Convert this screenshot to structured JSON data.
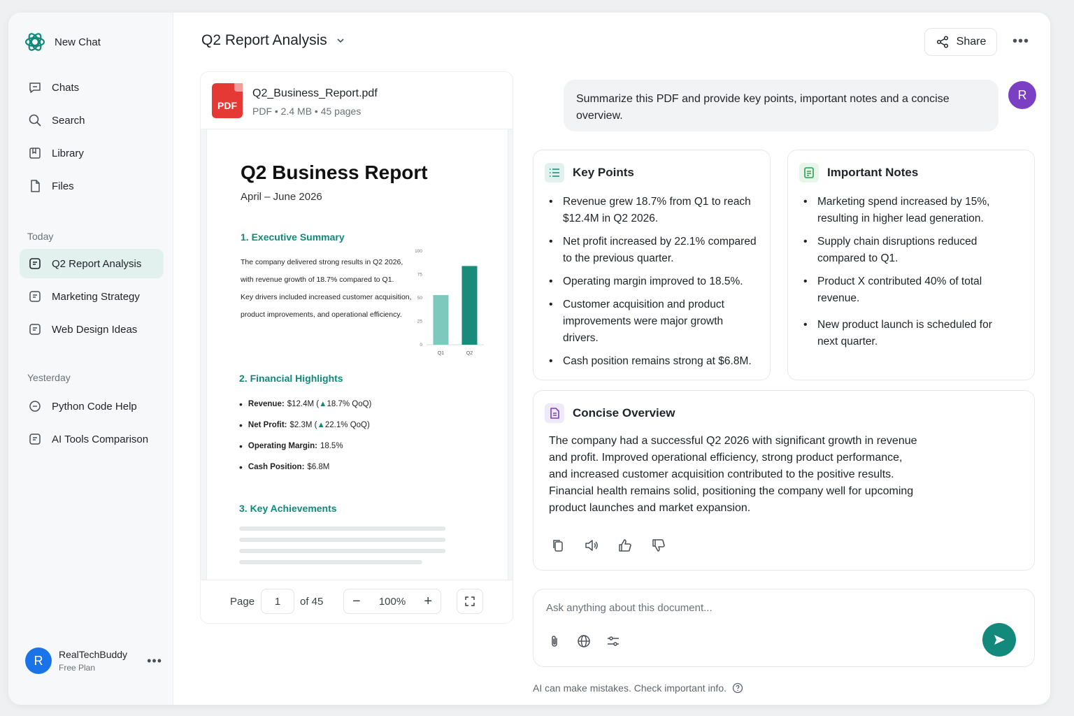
{
  "sidebar": {
    "new_chat": "New Chat",
    "nav": [
      {
        "label": "Chats"
      },
      {
        "label": "Search"
      },
      {
        "label": "Library"
      },
      {
        "label": "Files"
      }
    ],
    "today_label": "Today",
    "today": [
      {
        "label": "Q2 Report Analysis"
      },
      {
        "label": "Marketing Strategy"
      },
      {
        "label": "Web Design Ideas"
      }
    ],
    "yesterday_label": "Yesterday",
    "yesterday": [
      {
        "label": "Python Code Help"
      },
      {
        "label": "AI Tools Comparison"
      }
    ],
    "user": {
      "initial": "R",
      "name": "RealTechBuddy",
      "plan": "Free Plan"
    }
  },
  "header": {
    "title": "Q2 Report Analysis",
    "share": "Share"
  },
  "pdf": {
    "badge": "PDF",
    "file_name": "Q2_Business_Report.pdf",
    "file_meta": "PDF • 2.4 MB • 45 pages",
    "doc_title": "Q2 Business Report",
    "doc_subtitle": "April – June 2026",
    "sec1": "1. Executive Summary",
    "sec1_lines": [
      "The company delivered strong results in Q2 2026,",
      "with revenue growth of 18.7% compared to Q1.",
      "Key drivers included increased customer acquisition,",
      "product improvements, and operational efficiency."
    ],
    "sec2": "2. Financial Highlights",
    "fin": [
      {
        "label": "Revenue:",
        "value": "$12.4M (",
        "delta": "▲",
        "tail": " 18.7% QoQ)"
      },
      {
        "label": "Net Profit:",
        "value": "$2.3M (",
        "delta": "▲",
        "tail": " 22.1% QoQ)"
      },
      {
        "label": "Operating Margin:",
        "value": "18.5%",
        "delta": "",
        "tail": ""
      },
      {
        "label": "Cash Position:",
        "value": "$6.8M",
        "delta": "",
        "tail": ""
      }
    ],
    "sec3": "3. Key Achievements",
    "pager": {
      "page_label": "Page",
      "page": "1",
      "of": "of 45",
      "zoom": "100%"
    }
  },
  "chart_data": {
    "type": "bar",
    "categories": [
      "Q1",
      "Q2"
    ],
    "values": [
      53,
      84
    ],
    "ylim": [
      0,
      100
    ],
    "yticks": [
      "100",
      "75",
      "50",
      "25",
      "0"
    ],
    "colors": [
      "#7dc9bd",
      "#1a8a7a"
    ]
  },
  "chat": {
    "user_initial": "R",
    "user_message": "Summarize this PDF and provide key points, important notes and a concise overview.",
    "key_points_title": "Key Points",
    "key_points": [
      "Revenue grew 18.7% from Q1 to reach $12.4M in Q2 2026.",
      "Net profit increased by 22.1% compared to the previous quarter.",
      "Operating margin improved to 18.5%.",
      "Customer acquisition and product improvements were major growth drivers.",
      "Cash position remains strong at $6.8M."
    ],
    "notes_title": "Important Notes",
    "notes": [
      "Marketing spend increased by 15%, resulting in higher lead generation.",
      "Supply chain disruptions reduced compared to Q1.",
      "Product X contributed 40% of total revenue.",
      "New product launch is scheduled for next quarter."
    ],
    "overview_title": "Concise Overview",
    "overview": "The company had a successful Q2 2026 with significant growth in revenue and profit. Improved operational efficiency, strong product performance, and increased customer acquisition contributed to the positive results. Financial health remains solid, positioning the company well for upcoming product launches and market expansion.",
    "composer_placeholder": "Ask anything about this document...",
    "disclaimer": "AI can make mistakes. Check important info."
  },
  "colors": {
    "accent": "#12897a",
    "active_bg": "#e3f1ee",
    "pdf_red": "#e53935",
    "avatar_purple": "#7b3fc4",
    "avatar_blue": "#1a73e8"
  }
}
